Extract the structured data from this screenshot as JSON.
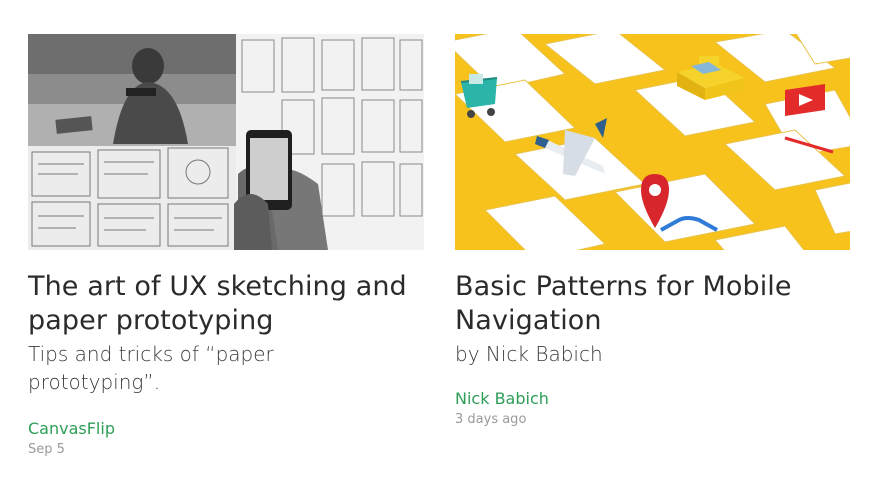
{
  "articles": [
    {
      "title": "The art of UX sketching and paper prototyping",
      "subtitle": "Tips and tricks of “paper prototyping”.",
      "author": "CanvasFlip",
      "date": "Sep 5",
      "image_icon": "sketching-photo"
    },
    {
      "title": "Basic Patterns for Mobile Navigation",
      "subtitle": "by Nick Babich",
      "author": "Nick Babich",
      "date": "3 days ago",
      "image_icon": "mobile-navigation-illustration"
    }
  ],
  "colors": {
    "author_link": "#2e9e57",
    "date": "#9a9a9a",
    "illustration_bg": "#f7c21c"
  }
}
